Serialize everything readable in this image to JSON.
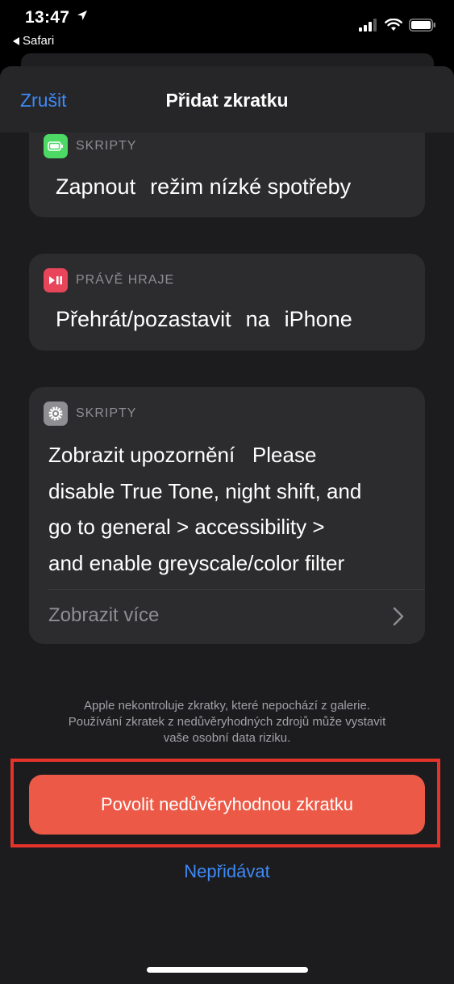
{
  "status_bar": {
    "time": "13:47",
    "back_app": "Safari",
    "location_icon": "location-arrow-icon",
    "signal_icon": "cellular-signal-icon",
    "wifi_icon": "wifi-icon",
    "battery_icon": "battery-icon"
  },
  "navbar": {
    "cancel_label": "Zrušit",
    "title": "Přidat zkratku"
  },
  "actions": [
    {
      "category": "SKRIPTY",
      "icon": "battery-icon",
      "icon_color": "#4cd964",
      "tokens": [
        "Zapnout",
        "režim nízké spotřeby"
      ]
    },
    {
      "category": "PRÁVĚ HRAJE",
      "icon": "play-pause-icon",
      "icon_color": "#e8445a",
      "tokens": [
        "Přehrát/pozastavit",
        "na",
        "iPhone"
      ]
    },
    {
      "category": "SKRIPTY",
      "icon": "gear-icon",
      "icon_color": "#8e8e93",
      "lines": [
        "Zobrazit upozornění   Please",
        "disable True Tone, night shift, and",
        "go to general > accessibility >",
        "and enable greyscale/color filter"
      ],
      "show_more": "Zobrazit více"
    }
  ],
  "warning_lines": [
    "Apple nekontroluje zkratky, které nepochází z galerie.",
    "Používání zkratek z nedůvěryhodných zdrojů může vystavit",
    "vaše osobní data riziku."
  ],
  "allow_button": "Povolit nedůvěryhodnou zkratku",
  "dont_add": "Nepřidávat",
  "colors": {
    "accent_blue": "#3e8af7",
    "danger_red": "#ec5a47",
    "highlight_red": "#e3332a"
  }
}
